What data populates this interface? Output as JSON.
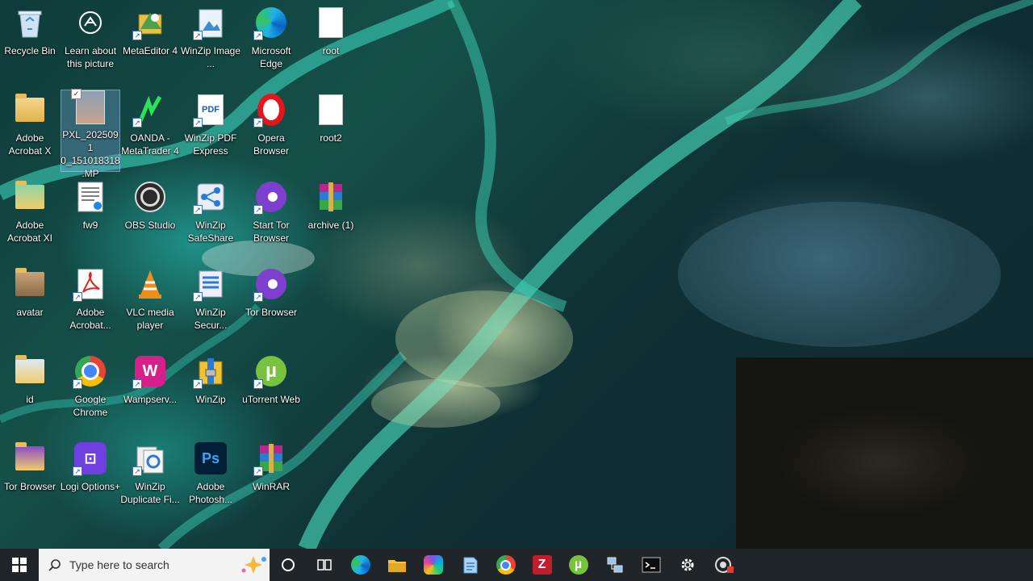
{
  "desktop": {
    "icons": [
      {
        "label": "Recycle Bin",
        "icon": "recycle-bin-icon"
      },
      {
        "label": "Learn about this picture",
        "icon": "camera-info-icon"
      },
      {
        "label": "MetaEditor 4",
        "icon": "metaeditor-icon"
      },
      {
        "label": "WinZip Image ...",
        "icon": "winzip-image-icon"
      },
      {
        "label": "Microsoft Edge",
        "icon": "edge-icon"
      },
      {
        "label": "root",
        "icon": "text-file-icon"
      },
      {
        "label": "Adobe Acrobat X",
        "icon": "folder-icon"
      },
      {
        "label": "PXL_2025091 0_151018318 .MP",
        "icon": "photo-thumbnail-icon"
      },
      {
        "label": "OANDA - MetaTrader 4",
        "icon": "metatrader-icon"
      },
      {
        "label": "WinZip PDF Express",
        "icon": "pdf-icon"
      },
      {
        "label": "Opera Browser",
        "icon": "opera-icon"
      },
      {
        "label": "root2",
        "icon": "text-file-icon"
      },
      {
        "label": "Adobe Acrobat XI",
        "icon": "folder-icon"
      },
      {
        "label": "fw9",
        "icon": "document-icon"
      },
      {
        "label": "OBS Studio",
        "icon": "obs-icon"
      },
      {
        "label": "WinZip SafeShare",
        "icon": "share-icon"
      },
      {
        "label": "Start Tor Browser",
        "icon": "tor-icon"
      },
      {
        "label": "archive (1)",
        "icon": "winrar-archive-icon"
      },
      {
        "label": "avatar",
        "icon": "folder-icon"
      },
      {
        "label": "Adobe Acrobat...",
        "icon": "acrobat-icon"
      },
      {
        "label": "VLC media player",
        "icon": "vlc-icon"
      },
      {
        "label": "WinZip Secur...",
        "icon": "winzip-secure-icon"
      },
      {
        "label": "Tor Browser",
        "icon": "tor-icon"
      },
      {
        "label": "id",
        "icon": "folder-icon"
      },
      {
        "label": "Google Chrome",
        "icon": "chrome-icon"
      },
      {
        "label": "Wampserv...",
        "icon": "wampserver-icon"
      },
      {
        "label": "WinZip",
        "icon": "winzip-icon"
      },
      {
        "label": "uTorrent Web",
        "icon": "utorrent-icon"
      },
      {
        "label": "Tor Browser",
        "icon": "folder-tor-icon"
      },
      {
        "label": "Logi Options+",
        "icon": "logi-icon"
      },
      {
        "label": "WinZip Duplicate Fi...",
        "icon": "winzip-duplicate-icon"
      },
      {
        "label": "Adobe Photosh...",
        "icon": "photoshop-icon"
      },
      {
        "label": "WinRAR",
        "icon": "winrar-icon"
      }
    ]
  },
  "taskbar": {
    "search_placeholder": "Type here to search",
    "buttons": [
      "start-icon",
      "search-icon",
      "cortana-icon",
      "task-view-icon",
      "edge-icon",
      "file-explorer-icon",
      "copilot-icon",
      "notepad-icon",
      "chrome-icon",
      "filezilla-icon",
      "utorrent-icon",
      "network-tool-icon",
      "terminal-icon",
      "settings-icon",
      "app-icon"
    ]
  },
  "colors": {
    "taskbar": "#1f2528",
    "search_box": "#f3f3f3",
    "accent": "#0078d7"
  }
}
